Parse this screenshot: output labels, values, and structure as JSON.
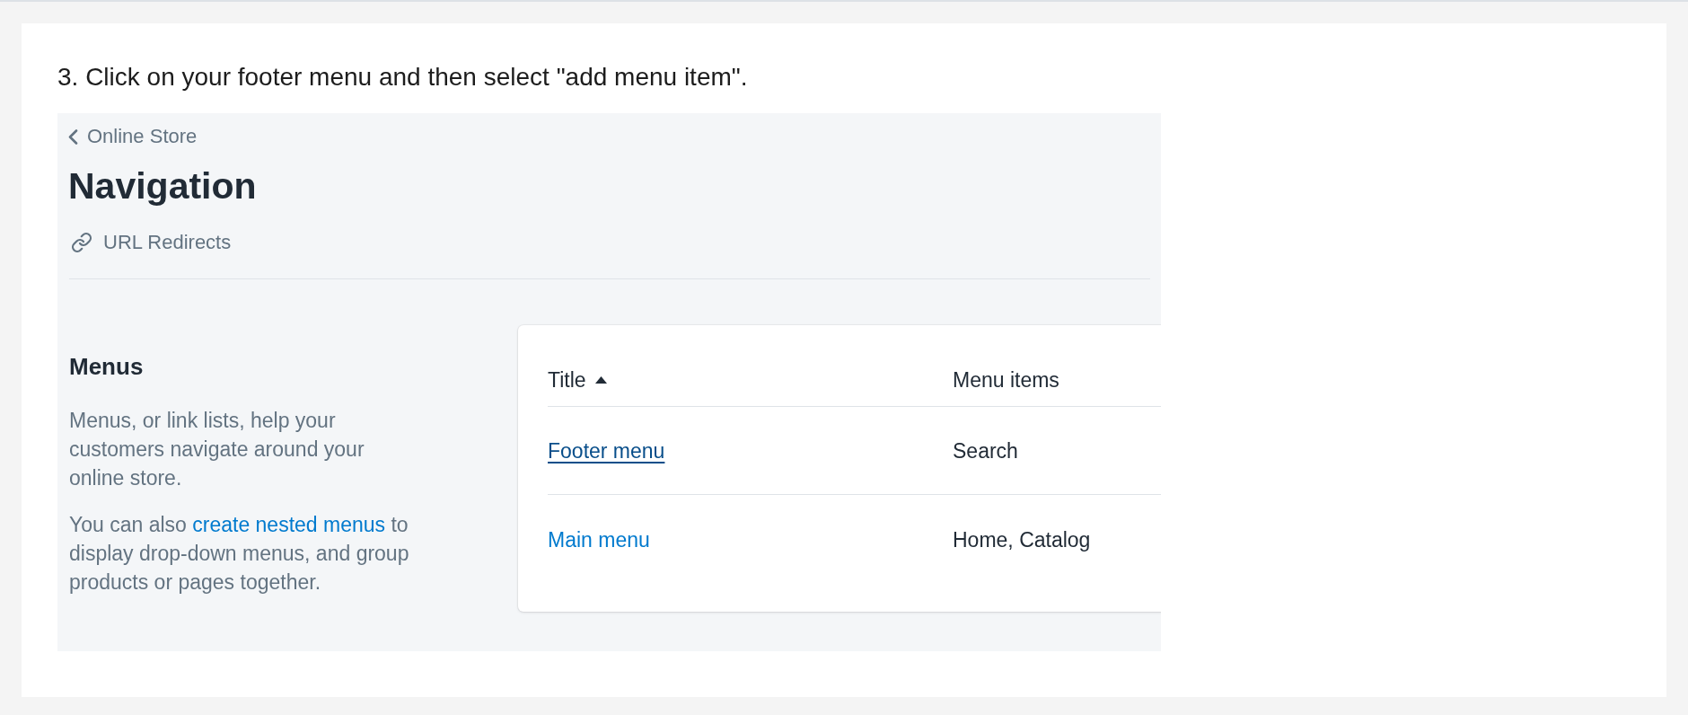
{
  "instruction": "3. Click on your footer menu and then select \"add menu item\".",
  "screenshot": {
    "breadcrumb": {
      "label": "Online Store"
    },
    "title": "Navigation",
    "actions": [
      {
        "label": "URL Redirects"
      }
    ],
    "section": {
      "heading": "Menus",
      "paragraphs": [
        [
          {
            "kind": "text",
            "text": "Menus, or link lists, help your customers navigate around your online store."
          }
        ],
        [
          {
            "kind": "text",
            "text": "You can also "
          },
          {
            "kind": "link",
            "text": "create nested menus"
          },
          {
            "kind": "text",
            "text": " to display drop-down menus, and group products or pages together."
          }
        ]
      ]
    },
    "table": {
      "columns": [
        {
          "label": "Title",
          "sorted": true
        },
        {
          "label": "Menu items",
          "sorted": false
        }
      ],
      "rows": [
        {
          "title": "Footer menu",
          "hovered": true,
          "items": "Search"
        },
        {
          "title": "Main menu",
          "hovered": false,
          "items": "Home, Catalog"
        }
      ]
    }
  }
}
